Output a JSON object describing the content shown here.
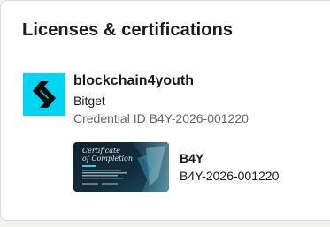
{
  "section": {
    "title": "Licenses & certifications"
  },
  "certification": {
    "name": "blockchain4youth",
    "issuer": "Bitget",
    "credential_id": "Credential ID B4Y-2026-001220",
    "logo_icon": "bitget-logo-icon",
    "logo_color": "#00d4f0",
    "media": {
      "title": "B4Y",
      "subtitle": "B4Y-2026-001220",
      "thumbnail_heading": "Certificate of Completion"
    }
  }
}
